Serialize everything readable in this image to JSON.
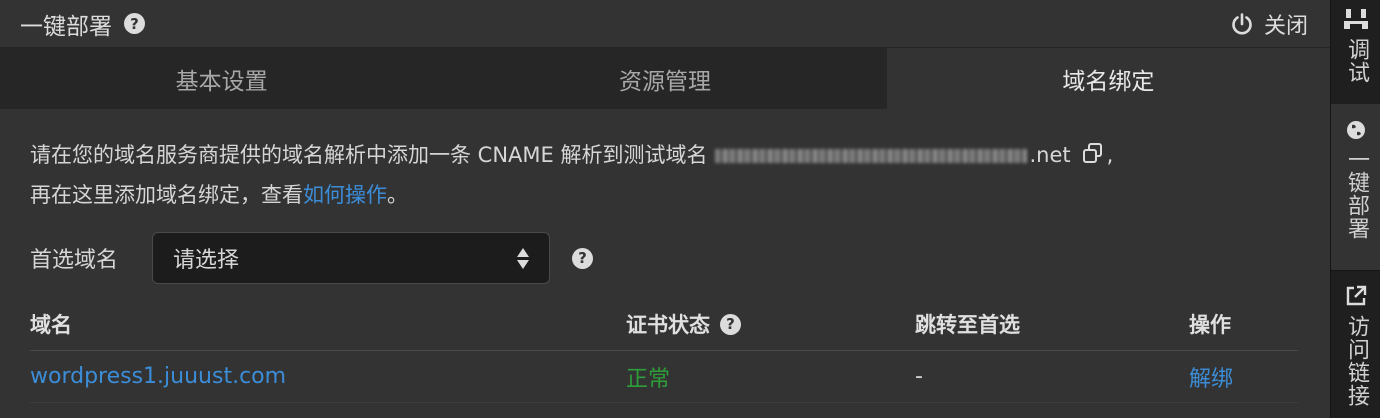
{
  "header": {
    "title": "一键部署",
    "close_label": "关闭"
  },
  "tabs": [
    {
      "label": "基本设置"
    },
    {
      "label": "资源管理"
    },
    {
      "label": "域名绑定"
    }
  ],
  "description": {
    "line1_text": "请在您的域名服务商提供的域名解析中添加一条 CNAME 解析到测试域名",
    "domain_suffix": ".net",
    "line1_end": ",",
    "line2_text": "再在这里添加域名绑定，查看",
    "link_text": "如何操作",
    "line2_end": "。"
  },
  "preferred_domain": {
    "label": "首选域名",
    "select_value": "请选择"
  },
  "table": {
    "headers": [
      "域名",
      "证书状态",
      "跳转至首选",
      "操作"
    ],
    "rows": [
      {
        "domain": "wordpress1.juuust.com",
        "cert_status": "正常",
        "redirect": "-",
        "action": "解绑"
      }
    ]
  },
  "sidebar": {
    "items": [
      {
        "label": "调试",
        "icon": "debug-icon"
      },
      {
        "label": "一键部署",
        "icon": "globe-icon"
      },
      {
        "label": "访问链接",
        "icon": "external-link-icon"
      }
    ]
  },
  "colors": {
    "link": "#3c8dd8",
    "status_ok": "#2e9e3a",
    "background": "#333333",
    "tab_bar": "#262626"
  }
}
